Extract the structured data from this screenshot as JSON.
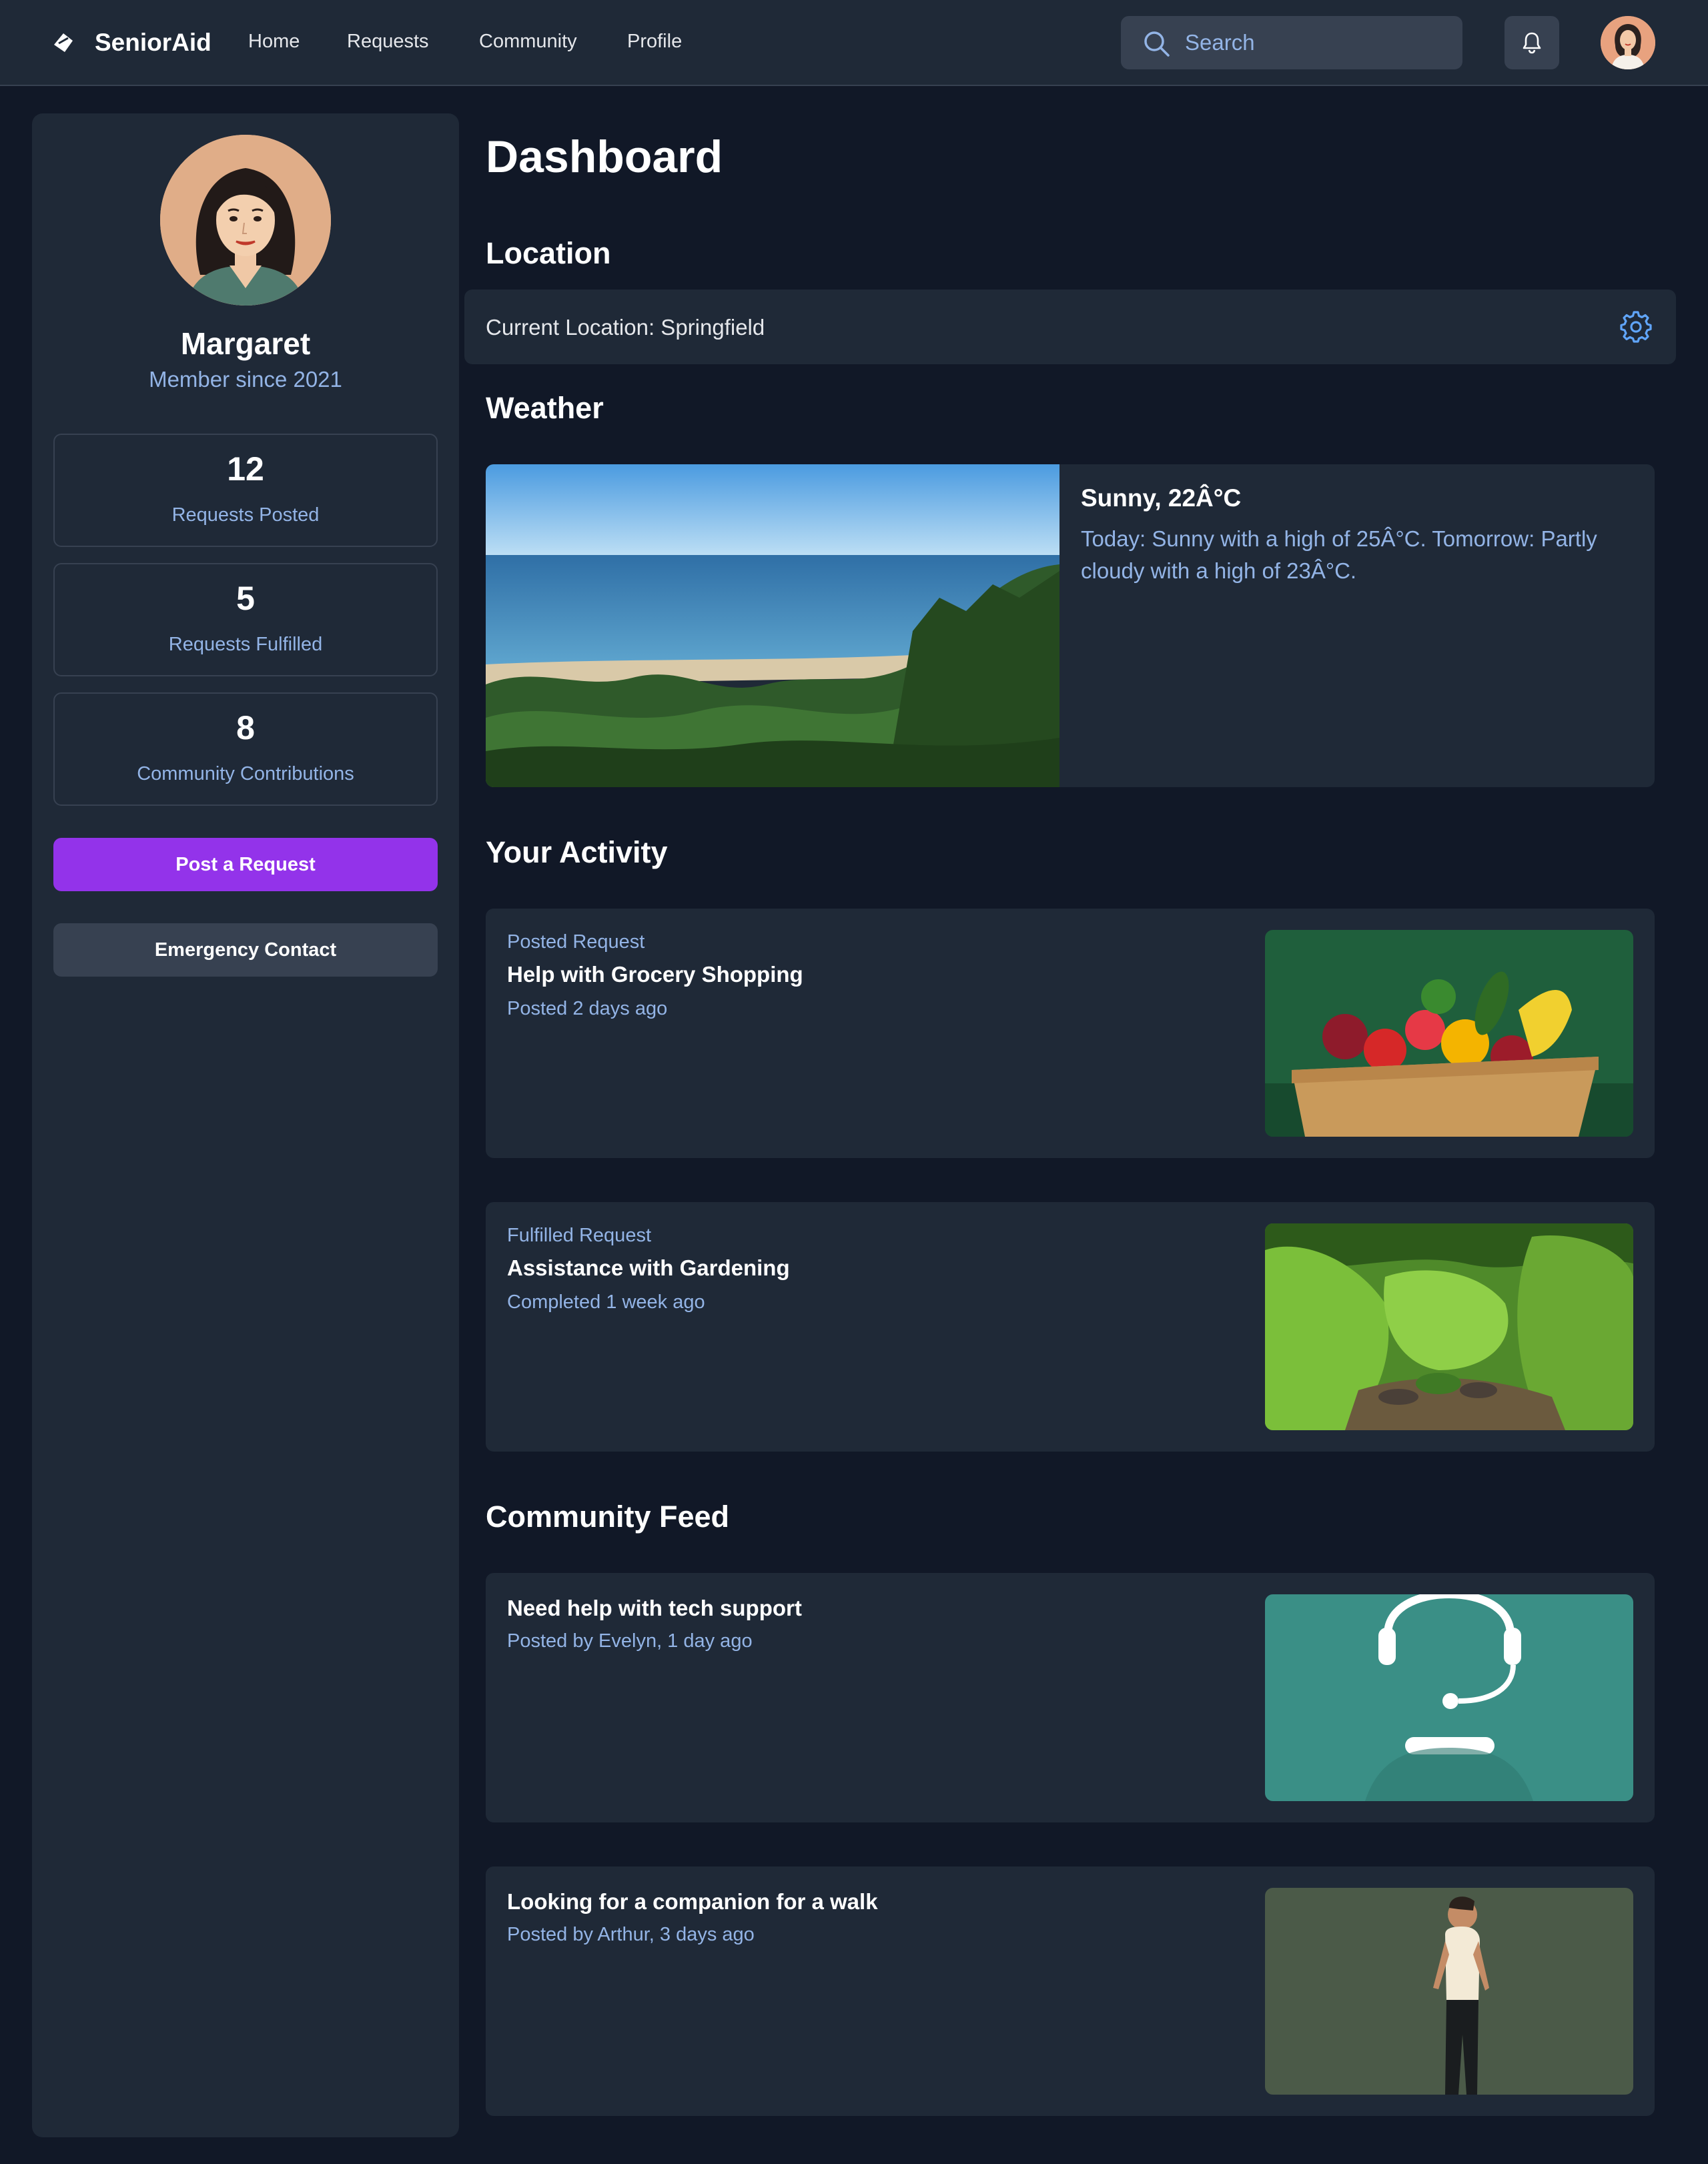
{
  "app": {
    "name": "SeniorAid"
  },
  "nav": {
    "items": [
      "Home",
      "Requests",
      "Community",
      "Profile"
    ]
  },
  "search": {
    "placeholder": "Search"
  },
  "profile": {
    "name": "Margaret",
    "member_since": "Member since 2021"
  },
  "stats": [
    {
      "value": "12",
      "label": "Requests Posted"
    },
    {
      "value": "5",
      "label": "Requests Fulfilled"
    },
    {
      "value": "8",
      "label": "Community Contributions"
    }
  ],
  "actions": {
    "post_request": "Post a Request",
    "emergency_contact": "Emergency Contact"
  },
  "dashboard": {
    "title": "Dashboard"
  },
  "location": {
    "heading": "Location",
    "current": "Current Location: Springfield"
  },
  "weather": {
    "heading": "Weather",
    "title": "Sunny, 22Â°C",
    "forecast": "Today: Sunny with a high of 25Â°C. Tomorrow: Partly cloudy with a high of 23Â°C."
  },
  "activity": {
    "heading": "Your Activity",
    "items": [
      {
        "type": "Posted Request",
        "title": "Help with Grocery Shopping",
        "meta": "Posted 2 days ago"
      },
      {
        "type": "Fulfilled Request",
        "title": "Assistance with Gardening",
        "meta": "Completed 1 week ago"
      }
    ]
  },
  "feed": {
    "heading": "Community Feed",
    "items": [
      {
        "title": "Need help with tech support",
        "meta": "Posted by Evelyn, 1 day ago"
      },
      {
        "title": "Looking for a companion for a walk",
        "meta": "Posted by Arthur, 3 days ago"
      }
    ]
  },
  "colors": {
    "background": "#111827",
    "surface": "#1f2937",
    "accent_purple": "#9333ea",
    "muted_blue": "#93b4e6",
    "icon_blue": "#60a5fa"
  },
  "icons": [
    "brand-logo-icon",
    "search-icon",
    "bell-icon",
    "gear-icon"
  ]
}
